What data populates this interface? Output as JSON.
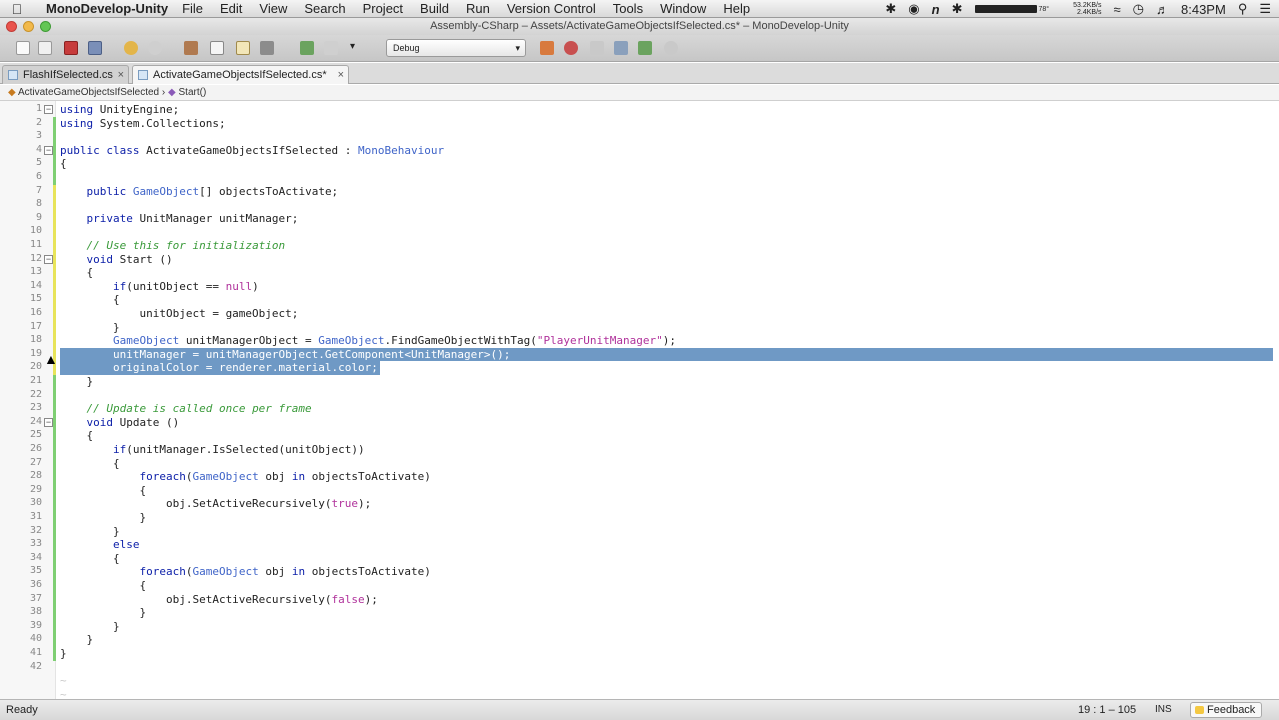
{
  "menubar": {
    "app_name": "MonoDevelop-Unity",
    "items": [
      "File",
      "Edit",
      "View",
      "Search",
      "Project",
      "Build",
      "Run",
      "Version Control",
      "Tools",
      "Window",
      "Help"
    ],
    "net_up": "53.2KB/s",
    "net_down": "2.4KB/s",
    "temp": "78°",
    "time": "8:43PM"
  },
  "window": {
    "title": "Assembly-CSharp – Assets/ActivateGameObjectsIfSelected.cs* – MonoDevelop-Unity"
  },
  "toolbar": {
    "configuration": "Debug"
  },
  "tabs": [
    {
      "label": "FlashIfSelected.cs",
      "active": false
    },
    {
      "label": "ActivateGameObjectsIfSelected.cs*",
      "active": true
    }
  ],
  "breadcrumb": {
    "class": "ActivateGameObjectsIfSelected",
    "separator": "›",
    "method": "Start()"
  },
  "editor": {
    "selected_lines": [
      19,
      20
    ],
    "lines": [
      "using UnityEngine;",
      "using System.Collections;",
      "",
      "public class ActivateGameObjectsIfSelected : MonoBehaviour",
      "{",
      "",
      "    public GameObject[] objectsToActivate;",
      "",
      "    private UnitManager unitManager;",
      "",
      "    // Use this for initialization",
      "    void Start ()",
      "    {",
      "        if(unitObject == null)",
      "        {",
      "            unitObject = gameObject;",
      "        }",
      "        GameObject unitManagerObject = GameObject.FindGameObjectWithTag(\"PlayerUnitManager\");",
      "        unitManager = unitManagerObject.GetComponent<UnitManager>();",
      "        originalColor = renderer.material.color;",
      "    }",
      "",
      "    // Update is called once per frame",
      "    void Update ()",
      "    {",
      "        if(unitManager.IsSelected(unitObject))",
      "        {",
      "            foreach(GameObject obj in objectsToActivate)",
      "            {",
      "                obj.SetActiveRecursively(true);",
      "            }",
      "        }",
      "        else",
      "        {",
      "            foreach(GameObject obj in objectsToActivate)",
      "            {",
      "                obj.SetActiveRecursively(false);",
      "            }",
      "        }",
      "    }",
      "}",
      ""
    ]
  },
  "statusbar": {
    "status": "Ready",
    "position": "19 : 1  –  105",
    "mode": "INS",
    "feedback": "Feedback"
  },
  "colors": {
    "selection": "#6f99c5",
    "keyword": "#0b1ea8",
    "type": "#3f64c8",
    "comment": "#3a9a3a",
    "string": "#b0329b"
  }
}
